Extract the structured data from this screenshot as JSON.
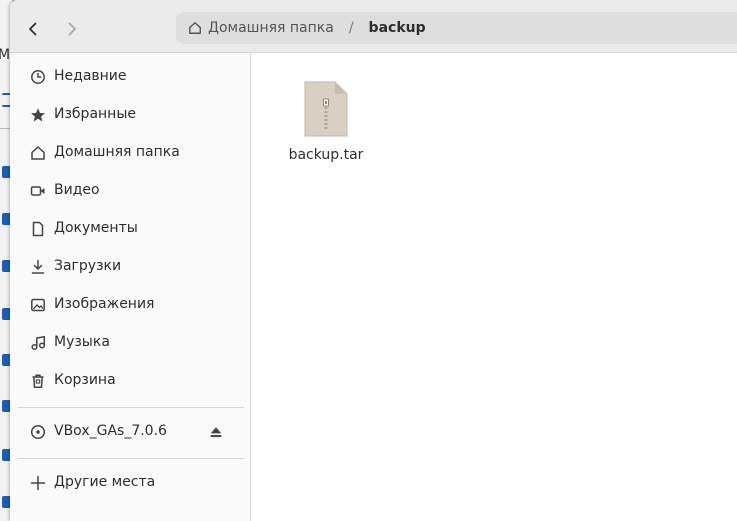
{
  "header": {
    "back_icon": "chevron-left-icon",
    "forward_icon": "chevron-right-icon",
    "breadcrumb": {
      "home_label": "Домашняя папка",
      "separator": "/",
      "current": "backup"
    }
  },
  "sidebar": {
    "places": [
      {
        "label": "Недавние",
        "icon": "clock-icon"
      },
      {
        "label": "Избранные",
        "icon": "star-icon"
      },
      {
        "label": "Домашняя папка",
        "icon": "home-icon"
      },
      {
        "label": "Видео",
        "icon": "video-icon"
      },
      {
        "label": "Документы",
        "icon": "document-icon"
      },
      {
        "label": "Загрузки",
        "icon": "download-icon"
      },
      {
        "label": "Изображения",
        "icon": "image-icon"
      },
      {
        "label": "Музыка",
        "icon": "music-icon"
      },
      {
        "label": "Корзина",
        "icon": "trash-icon"
      }
    ],
    "devices": [
      {
        "label": "VBox_GAs_7.0.6",
        "icon": "disc-icon",
        "action_icon": "eject-icon"
      }
    ],
    "other": {
      "label": "Другие места",
      "icon": "plus-icon"
    }
  },
  "files": [
    {
      "name": "backup.tar",
      "icon": "archive-icon"
    }
  ],
  "background": {
    "partial_text": "Мо"
  },
  "colors": {
    "accent": "#1a5fb4",
    "file_icon": "#d9d0c3"
  }
}
